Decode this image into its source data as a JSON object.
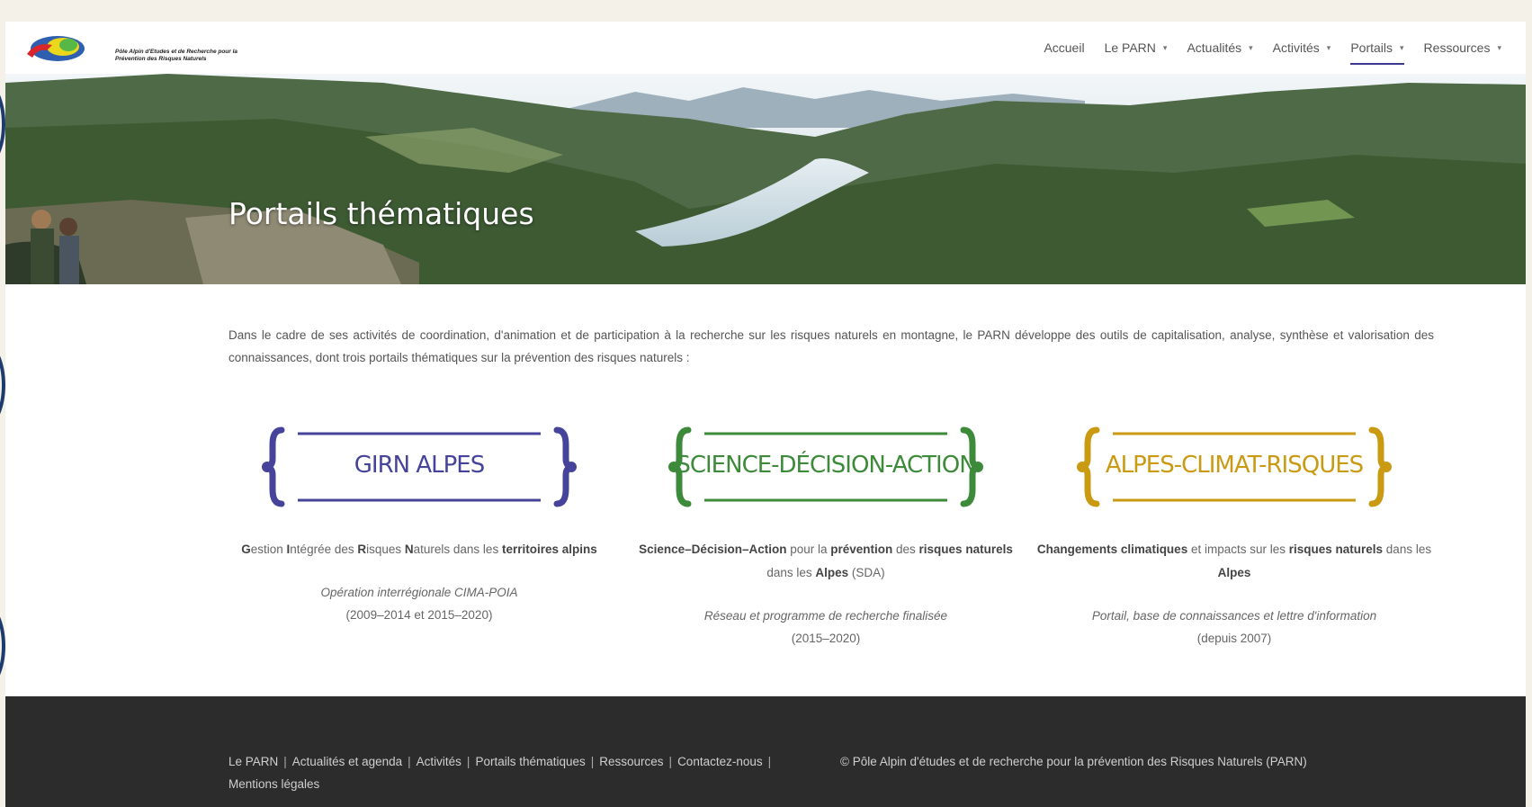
{
  "header": {
    "logo_text": "Pôle Alpin d'Etudes et de Recherche pour la Prévention des Risques Naturels",
    "nav": [
      {
        "label": "Accueil",
        "has_dropdown": false,
        "active": false
      },
      {
        "label": "Le PARN",
        "has_dropdown": true,
        "active": false
      },
      {
        "label": "Actualités",
        "has_dropdown": true,
        "active": false
      },
      {
        "label": "Activités",
        "has_dropdown": true,
        "active": false
      },
      {
        "label": "Portails",
        "has_dropdown": true,
        "active": true
      },
      {
        "label": "Ressources",
        "has_dropdown": true,
        "active": false
      }
    ]
  },
  "hero": {
    "title": "Portails thématiques"
  },
  "intro": {
    "text": "Dans le cadre de ses activités de coordination, d'animation et de participation à la recherche sur les risques naturels en montagne, le PARN développe des outils de capitalisation, analyse, synthèse et valorisation des connaissances, dont trois portails thématiques sur la prévention des risques naturels :"
  },
  "portals": [
    {
      "name": "GIRN ALPES",
      "color": "#46449a",
      "desc_html": "<b>G</b>estion <b>I</b>ntégrée des <b>R</b>isques <b>N</b>aturels dans les <b>territoires alpins</b>",
      "sub_italic": "Opération interrégionale CIMA-POIA",
      "sub_plain": "(2009–2014 et 2015–2020)"
    },
    {
      "name": "SCIENCE-DÉCISION-ACTION",
      "color": "#3d8a3a",
      "desc_html": "<b>Science–Décision–Action</b> pour la <b>prévention</b> des <b>risques naturels</b> dans les <b>Alpes</b> (SDA)",
      "sub_italic": "Réseau et programme de recherche finalisée",
      "sub_plain": "(2015–2020)"
    },
    {
      "name": "ALPES-CLIMAT-RISQUES",
      "color": "#c99a12",
      "desc_html": "<b>Changements climatiques</b> et impacts sur les <b>risques naturels</b> dans les <b>Alpes</b>",
      "sub_italic": "Portail, base de connaissances et lettre d'information",
      "sub_plain": "(depuis 2007)"
    }
  ],
  "footer": {
    "links": [
      "Le PARN",
      "Actualités et agenda",
      "Activités",
      "Portails thématiques",
      "Ressources",
      "Contactez-nous",
      "Mentions légales"
    ],
    "copyright": "© Pôle Alpin d'études et de recherche pour la prévention des Risques Naturels (PARN)"
  }
}
